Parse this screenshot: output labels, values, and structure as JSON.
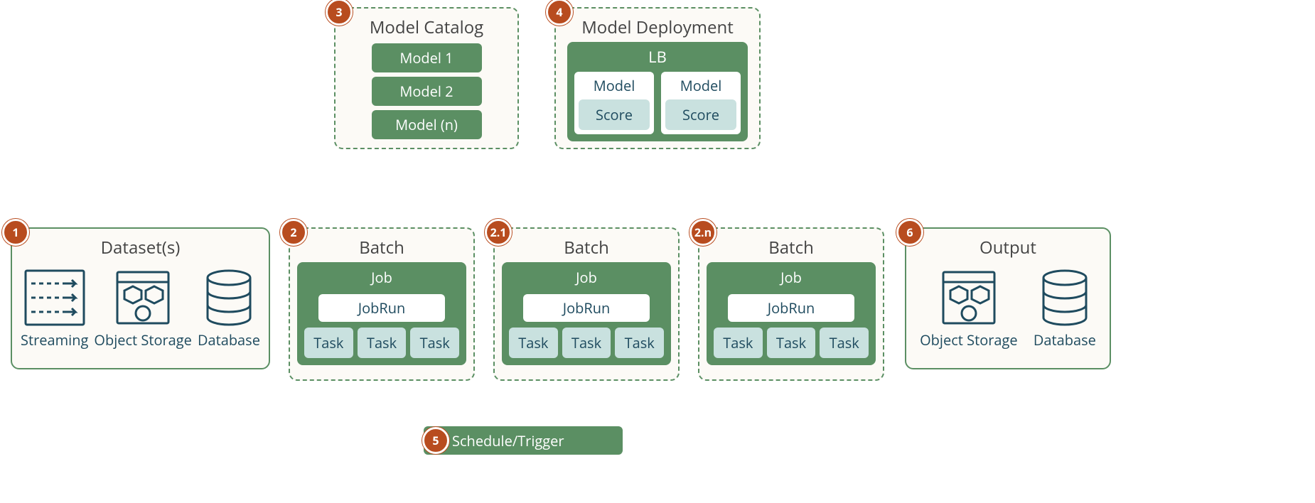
{
  "panels": {
    "catalog": {
      "badge": "3",
      "title": "Model Catalog",
      "models": [
        "Model 1",
        "Model 2",
        "Model (n)"
      ]
    },
    "deployment": {
      "badge": "4",
      "title": "Model Deployment",
      "lb": "LB",
      "pods": [
        {
          "model": "Model",
          "score": "Score"
        },
        {
          "model": "Model",
          "score": "Score"
        }
      ]
    },
    "datasets": {
      "badge": "1",
      "title": "Dataset(s)",
      "items": [
        {
          "label": "Streaming"
        },
        {
          "label": "Object Storage"
        },
        {
          "label": "Database"
        }
      ]
    },
    "batches": [
      {
        "badge": "2",
        "title": "Batch",
        "job": "Job",
        "jobrun": "JobRun",
        "tasks": [
          "Task",
          "Task",
          "Task"
        ]
      },
      {
        "badge": "2.1",
        "title": "Batch",
        "job": "Job",
        "jobrun": "JobRun",
        "tasks": [
          "Task",
          "Task",
          "Task"
        ]
      },
      {
        "badge": "2.n",
        "title": "Batch",
        "job": "Job",
        "jobrun": "JobRun",
        "tasks": [
          "Task",
          "Task",
          "Task"
        ]
      }
    ],
    "schedule": {
      "badge": "5",
      "label": "Schedule/Trigger"
    },
    "output": {
      "badge": "6",
      "title": "Output",
      "items": [
        {
          "label": "Object Storage"
        },
        {
          "label": "Database"
        }
      ]
    }
  },
  "colors": {
    "green": "#5B8F63",
    "orange": "#B84C1F",
    "teal": "#1F4B5F",
    "paleTeal": "#C9E1DF",
    "cream": "#FCFAF6"
  }
}
